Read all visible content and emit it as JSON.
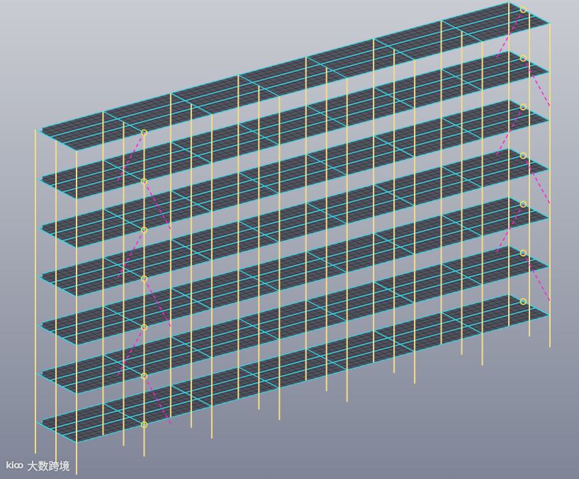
{
  "model": {
    "stories": 7,
    "grid_cells_u": 24,
    "grid_cells_v": 10,
    "bays": 7,
    "braced_bays": [
      "left-end",
      "right-end"
    ]
  },
  "colors": {
    "background_top": "#c9ccd2",
    "background_bottom": "#7f8497",
    "slab_fill": "#4a4d57",
    "mesh_line": "#1b1c22",
    "beam": "#34d7ea",
    "column": "#f2dc8c",
    "brace": "#ff1ee0",
    "node": "#f5e54a"
  },
  "icons": {
    "watermark": "dashu-logo-icon"
  },
  "watermark": {
    "logo_text": "kiꝏ",
    "text": "大数跨境"
  }
}
